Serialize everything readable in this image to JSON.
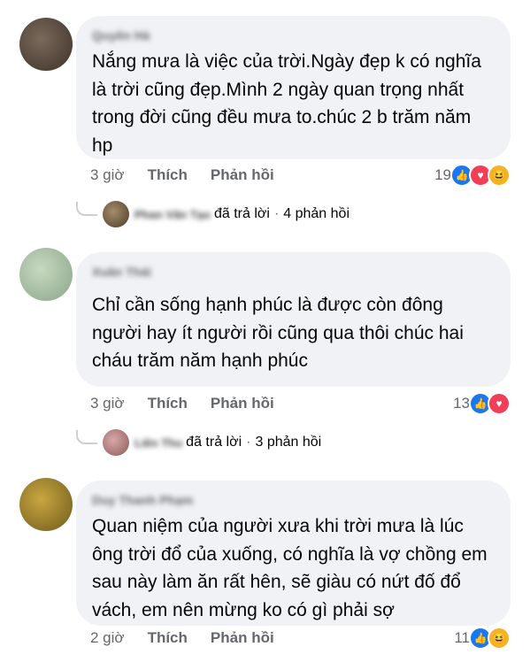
{
  "comments": [
    {
      "author": "Quyên Hà",
      "text": "Nắng mưa là việc của trời.Ngày đẹp k có nghĩa là trời cũng đẹp.Mình 2 ngày quan trọng nhất trong đời cũng đều mưa to.chúc 2 b trăm năm hp",
      "time": "3 giờ",
      "like_label": "Thích",
      "reply_label": "Phản hồi",
      "reaction_count": "19",
      "reactions": [
        "like-icon",
        "love-icon",
        "haha-icon"
      ],
      "replies": {
        "replier": "Phan Văn Tạo",
        "action": "đã trả lời",
        "count_text": "4 phản hồi"
      }
    },
    {
      "author": "Xuân Thái",
      "text": "Chỉ cần sống hạnh phúc là được còn đông người hay ít người rồi cũng qua thôi chúc hai cháu trăm năm hạnh phúc",
      "time": "3 giờ",
      "like_label": "Thích",
      "reply_label": "Phản hồi",
      "reaction_count": "13",
      "reactions": [
        "like-icon",
        "love-icon"
      ],
      "replies": {
        "replier": "Liên Thu",
        "action": "đã trả lời",
        "count_text": "3 phản hồi"
      }
    },
    {
      "author": "Duy Thanh Phạm",
      "text": "Quan niệm của người xưa khi trời mưa là lúc ông trời đổ của xuống, có nghĩa là vợ chồng em sau này làm ăn rất hên, sẽ giàu có nứt đố đổ vách, em nên mừng ko có gì phải sợ",
      "time": "2 giờ",
      "like_label": "Thích",
      "reply_label": "Phản hồi",
      "reaction_count": "11",
      "reactions": [
        "like-icon",
        "haha-icon"
      ]
    }
  ],
  "colors": {
    "bubble": "#f0f2f5",
    "secondary_text": "#65676b",
    "like": "#1877f2",
    "love": "#f33e58",
    "haha": "#f7b125"
  }
}
